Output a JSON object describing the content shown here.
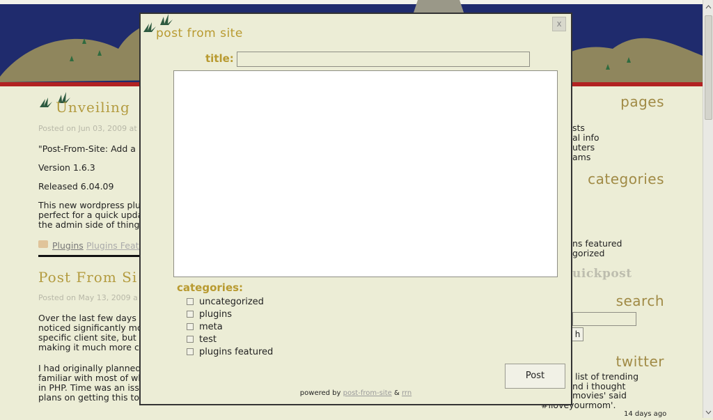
{
  "blog": {
    "posts": [
      {
        "title": "Unveiling",
        "meta": "Posted on Jun 03, 2009 at",
        "lines": [
          "\"Post-From-Site: Add a",
          "Version 1.6.3",
          "Released 6.04.09",
          "This new wordpress plu",
          "perfect for a quick upda",
          "the admin side of thing"
        ],
        "tags": [
          "Plugins",
          "Plugins Featu"
        ]
      },
      {
        "title": "Post From Si",
        "meta": "Posted on May 13, 2009 a",
        "lines": [
          "Over the last few days I",
          "noticed significantly mo",
          "specific client site, but",
          "making it much more cu",
          "I had originally planned",
          "familiar with most of wh",
          "in PHP. Time was an iss",
          "plans on getting this to"
        ]
      }
    ],
    "sidebar": {
      "pages_heading": "pages",
      "pages": [
        "sts",
        "al info",
        "uters",
        "ams"
      ],
      "categories_heading": "categories",
      "categories": [
        "ns featured",
        "gorized"
      ],
      "quickpost_heading": "uickpost",
      "search_heading": "search",
      "search_button": "h",
      "twitter_heading": "twitter",
      "tweet_lines": [
        "list of trending",
        "nd i thought",
        "movies' said",
        "#iloveyourmom'."
      ],
      "tweet_time": "14 days ago"
    }
  },
  "overlay": {
    "title": "post from site",
    "close_label": "x",
    "title_label": "title:",
    "title_value": "",
    "body_value": "",
    "categories_label": "categories:",
    "categories": [
      "uncategorized",
      "plugins",
      "meta",
      "test",
      "plugins featured"
    ],
    "post_button": "Post",
    "powered_prefix": "powered by",
    "powered_link1": "post-from-site",
    "powered_amp": "&",
    "powered_link2": "rrn"
  },
  "colors": {
    "accent": "#b89a30",
    "background": "#ecedd6",
    "header_night": "#1e2a6e",
    "hills": "#8f865d",
    "red_band": "#b22222"
  }
}
